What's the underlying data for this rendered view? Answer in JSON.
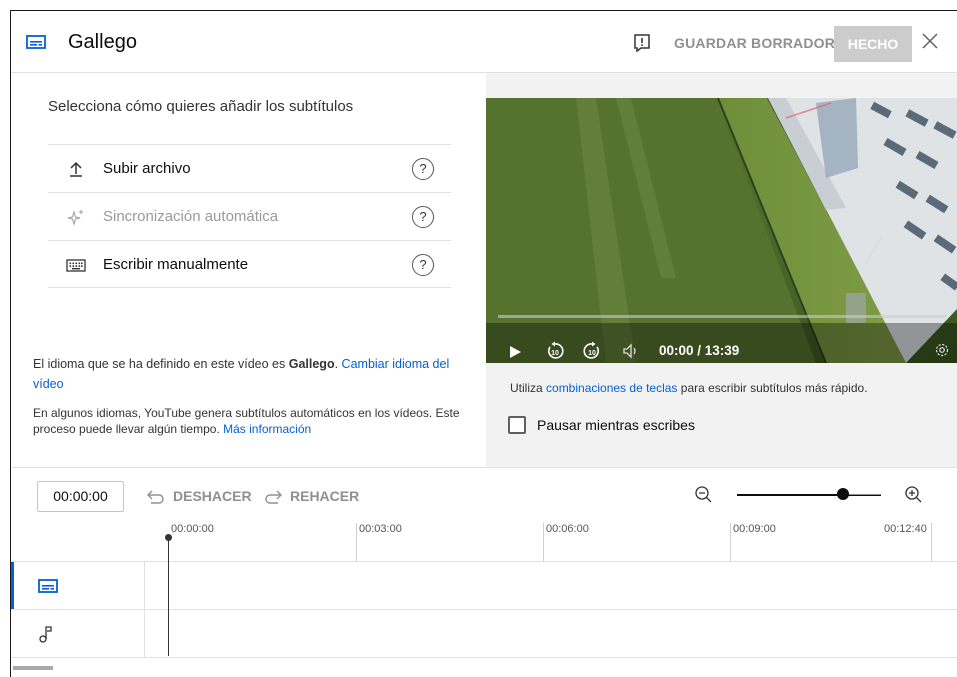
{
  "header": {
    "title": "Gallego",
    "save_label": "GUARDAR BORRADOR",
    "done_label": "HECHO"
  },
  "left": {
    "prompt": "Selecciona cómo quieres añadir los subtítulos",
    "options": [
      {
        "label": "Subir archivo",
        "help": "?",
        "icon": "upload-icon"
      },
      {
        "label": "Sincronización automática",
        "help": "?",
        "icon": "sparkle-icon"
      },
      {
        "label": "Escribir manualmente",
        "help": "?",
        "icon": "keyboard-icon"
      }
    ],
    "info1_prefix": "El idioma que se ha definido en este vídeo es ",
    "info1_language": "Gallego",
    "info1_dot": ".",
    "info1_link": "Cambiar idioma del vídeo",
    "info2_text": "En algunos idiomas, YouTube genera subtítulos automáticos en los vídeos. Este proceso puede llevar algún tiempo.",
    "info2_link": "Más información"
  },
  "player": {
    "time": "00:00 / 13:39",
    "progress": 0,
    "tip_prefix": "Utiliza ",
    "tip_link": "combinaciones de teclas",
    "tip_suffix": " para escribir subtítulos más rápido.",
    "pause_label": "Pausar mientras escribes",
    "pause_checked": false
  },
  "timeline": {
    "timecode": "00:00:00",
    "undo_label": "DESHACER",
    "redo_label": "REHACER",
    "zoom_level": 0.75,
    "ticks": [
      "00:00:00",
      "00:03:00",
      "00:06:00",
      "00:09:00",
      "00:12:40"
    ]
  },
  "colors": {
    "accent": "#065fd4",
    "disabled_button": "#cccccc"
  }
}
